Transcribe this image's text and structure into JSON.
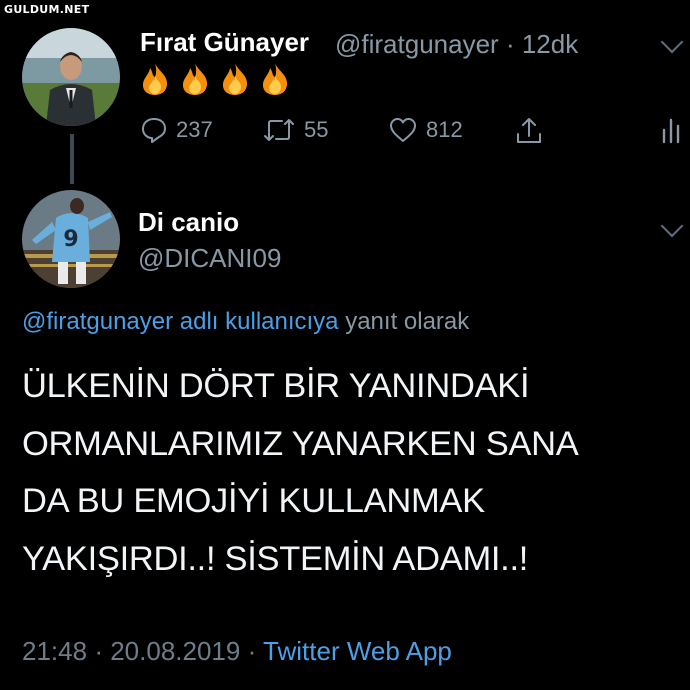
{
  "watermark": "GULDUM.NET",
  "parent_tweet": {
    "name": "Fırat Günayer",
    "handle": "@firatgunayer",
    "separator": "·",
    "time_ago": "12dk",
    "emojis": [
      "fire-emoji",
      "fire-emoji",
      "fire-emoji",
      "fire-emoji"
    ],
    "actions": {
      "replies": "237",
      "retweets": "55",
      "likes": "812"
    }
  },
  "reply_tweet": {
    "name": "Di canio",
    "handle": "@DICANI09",
    "reply_to_link": "@firatgunayer adlı kullanıcıya",
    "reply_to_suffix": "yanıt olarak",
    "text_lines": [
      "ÜLKENİN DÖRT BİR YANINDAKİ",
      "ORMANLARIMIZ YANARKEN SANA",
      "DA BU EMOJİYİ KULLANMAK",
      "YAKIŞIRDI..! SİSTEMİN ADAMI..!"
    ],
    "time": "21:48",
    "date": "20.08.2019",
    "separator": "·",
    "source": "Twitter Web App"
  },
  "colors": {
    "background": "#000000",
    "link_blue": "#4d9fe6",
    "muted_gray": "#8899a6",
    "thread_line": "#3d4a55"
  }
}
